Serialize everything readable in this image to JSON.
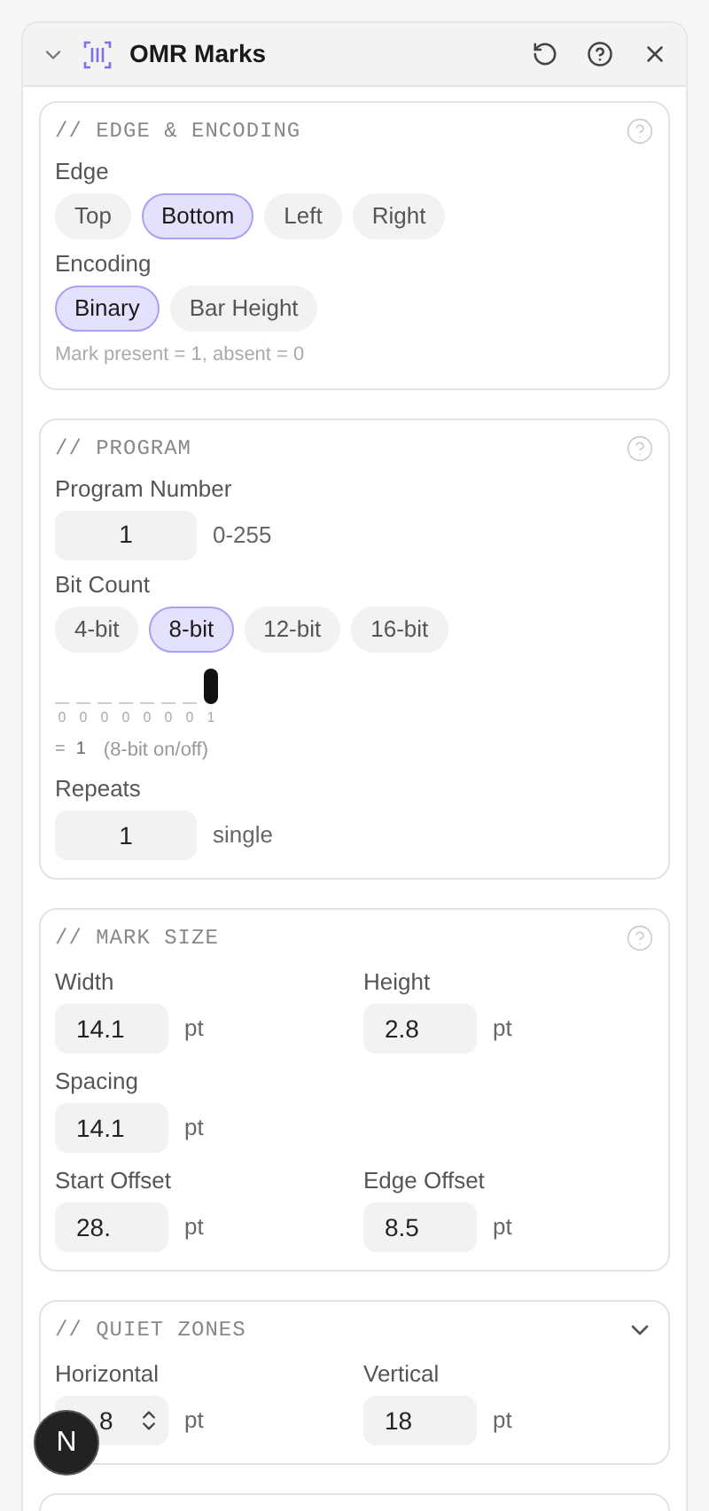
{
  "panel": {
    "title": "OMR Marks",
    "expanded": true
  },
  "sections": [
    {
      "title": "// EDGE & ENCODING",
      "collapsible": false,
      "rows": [
        {
          "kind": "choice",
          "label": "Edge",
          "options": [
            {
              "label": "Top",
              "selected": false
            },
            {
              "label": "Bottom",
              "selected": true
            },
            {
              "label": "Left",
              "selected": false
            },
            {
              "label": "Right",
              "selected": false
            }
          ]
        },
        {
          "kind": "choice",
          "label": "Encoding",
          "options": [
            {
              "label": "Binary",
              "selected": true
            },
            {
              "label": "Bar Height",
              "selected": false
            }
          ]
        },
        {
          "kind": "note",
          "text": "Mark present = 1, absent = 0"
        }
      ]
    },
    {
      "title": "// PROGRAM",
      "collapsible": false,
      "rows": [
        {
          "kind": "number",
          "label": "Program Number",
          "value": "1",
          "hint": "0-255"
        },
        {
          "kind": "choice",
          "label": "Bit Count",
          "options": [
            {
              "label": "4-bit",
              "selected": false
            },
            {
              "label": "8-bit",
              "selected": true
            },
            {
              "label": "12-bit",
              "selected": false
            },
            {
              "label": "16-bit",
              "selected": false
            }
          ]
        },
        {
          "kind": "bits",
          "bits": [
            {
              "label": "0",
              "on": false
            },
            {
              "label": "0",
              "on": false
            },
            {
              "label": "0",
              "on": false
            },
            {
              "label": "0",
              "on": false
            },
            {
              "label": "0",
              "on": false
            },
            {
              "label": "0",
              "on": false
            },
            {
              "label": "0",
              "on": false
            },
            {
              "label": "1",
              "on": true
            }
          ],
          "equals": "=",
          "result": "1",
          "caption": "(8-bit on/off)"
        },
        {
          "kind": "number",
          "label": "Repeats",
          "value": "1",
          "hint": "single"
        }
      ]
    },
    {
      "title": "// MARK SIZE",
      "collapsible": false,
      "rows": [
        {
          "kind": "grid",
          "fields": [
            {
              "label": "Width",
              "value": "14.1",
              "unit": "pt",
              "spinner": false
            },
            {
              "label": "Height",
              "value": "2.8",
              "unit": "pt",
              "spinner": false
            }
          ]
        },
        {
          "kind": "grid",
          "fields": [
            {
              "label": "Spacing",
              "value": "14.1",
              "unit": "pt",
              "spinner": false
            }
          ]
        },
        {
          "kind": "grid",
          "fields": [
            {
              "label": "Start Offset",
              "value": "28.",
              "unit": "pt",
              "spinner": false
            },
            {
              "label": "Edge Offset",
              "value": "8.5",
              "unit": "pt",
              "spinner": false
            }
          ]
        }
      ]
    },
    {
      "title": "// QUIET ZONES",
      "collapsible": true,
      "rows": [
        {
          "kind": "grid",
          "fields": [
            {
              "label": "Horizontal",
              "value": "8",
              "unit": "pt",
              "spinner": true
            },
            {
              "label": "Vertical",
              "value": "18",
              "unit": "pt",
              "spinner": false
            }
          ]
        }
      ]
    }
  ],
  "badge": {
    "letter": "N"
  }
}
